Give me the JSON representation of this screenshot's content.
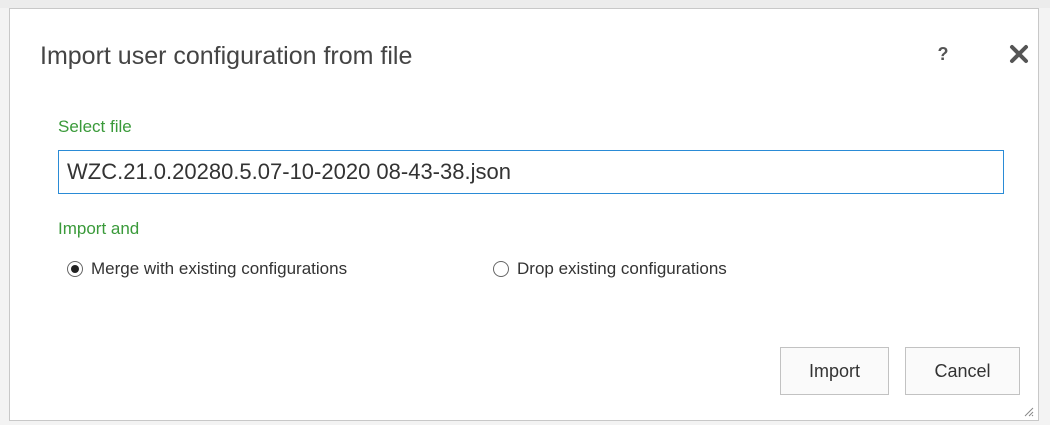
{
  "dialog": {
    "title": "Import user configuration from file",
    "help_label": "?",
    "close_icon": "close-icon",
    "resize_icon": "resize-grip-icon"
  },
  "file": {
    "label": "Select file",
    "value": "WZC.21.0.20280.5.07-10-2020 08-43-38.json"
  },
  "import_mode": {
    "label": "Import and",
    "options": [
      {
        "label": "Merge with existing configurations",
        "selected": true
      },
      {
        "label": "Drop existing configurations",
        "selected": false
      }
    ]
  },
  "buttons": {
    "import_label": "Import",
    "cancel_label": "Cancel"
  },
  "colors": {
    "accent_green": "#3a9a3a",
    "focus_blue": "#2a8bd6"
  }
}
